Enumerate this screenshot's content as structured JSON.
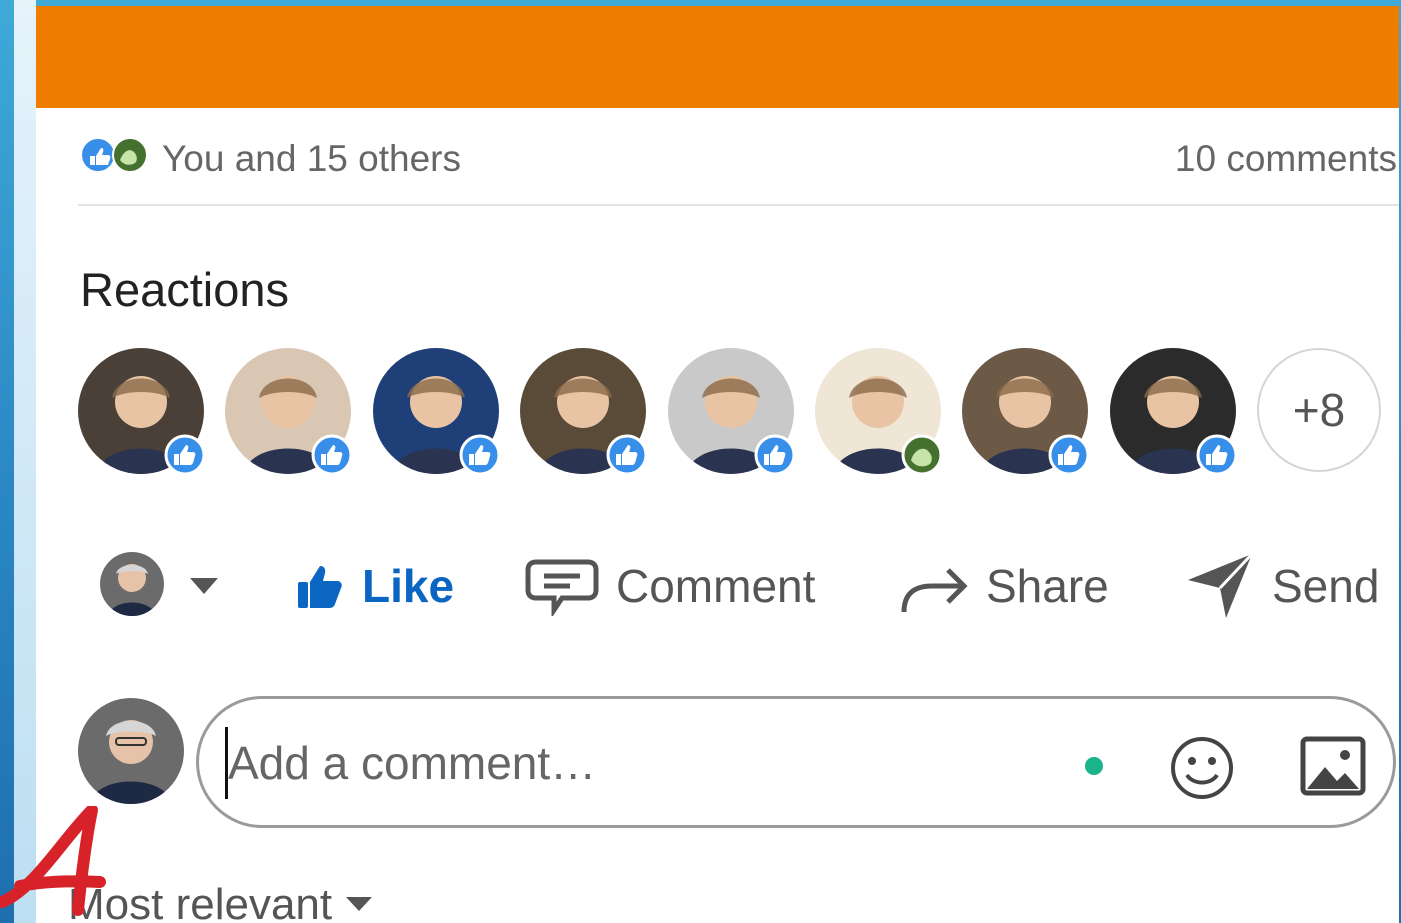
{
  "post": {
    "reaction_summary": "You and 15 others",
    "comments_count": "10 comments"
  },
  "reactions": {
    "title": "Reactions",
    "people": [
      {
        "name": "reactor-1",
        "reaction": "like-icon",
        "bg": "#4a4038"
      },
      {
        "name": "reactor-2",
        "reaction": "like-icon",
        "bg": "#d9c7b4"
      },
      {
        "name": "reactor-3",
        "reaction": "like-icon",
        "bg": "#1f3f78"
      },
      {
        "name": "reactor-4",
        "reaction": "like-icon",
        "bg": "#5a4a38"
      },
      {
        "name": "reactor-5",
        "reaction": "like-icon",
        "bg": "#c9c9c9"
      },
      {
        "name": "reactor-6",
        "reaction": "celebrate-icon",
        "bg": "#efe6d6"
      },
      {
        "name": "reactor-7",
        "reaction": "like-icon",
        "bg": "#6d5a46"
      },
      {
        "name": "reactor-8",
        "reaction": "like-icon",
        "bg": "#2b2b2b"
      }
    ],
    "more_label": "+8"
  },
  "actions": {
    "like": "Like",
    "comment": "Comment",
    "share": "Share",
    "send": "Send"
  },
  "composer": {
    "placeholder": "Add a comment…"
  },
  "sort": {
    "label": "Most relevant"
  },
  "colors": {
    "banner": "#ee7d00",
    "like_blue": "#0a66c2",
    "online": "#1bb38a"
  }
}
